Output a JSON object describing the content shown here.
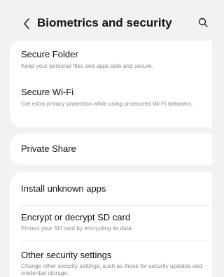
{
  "header": {
    "title": "Biometrics and security",
    "back_icon": "chevron-left-icon",
    "search_icon": "search-icon"
  },
  "groups": [
    {
      "items": [
        {
          "title": "Secure Folder",
          "subtitle": "Keep your personal files and apps safe and secure."
        },
        {
          "title": "Secure Wi-Fi",
          "subtitle": "Get extra privacy protection while using unsecured Wi-Fi networks."
        }
      ]
    },
    {
      "items": [
        {
          "title": "Private Share"
        }
      ]
    },
    {
      "items": [
        {
          "title": "Install unknown apps"
        },
        {
          "title": "Encrypt or decrypt SD card",
          "subtitle": "Protect your SD card by encrypting its data."
        },
        {
          "title": "Other security settings",
          "subtitle": "Change other security settings, such as those for security updates and credential storage."
        }
      ]
    }
  ]
}
